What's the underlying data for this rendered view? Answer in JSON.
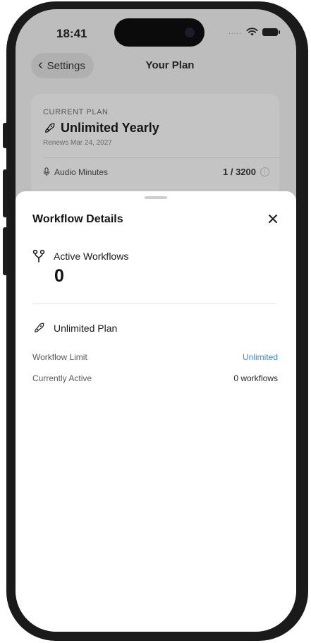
{
  "status_bar": {
    "time": "18:41",
    "signal_text": "....."
  },
  "nav": {
    "back_label": "Settings",
    "title": "Your Plan"
  },
  "plan_card": {
    "label": "CURRENT PLAN",
    "name": "Unlimited Yearly",
    "renews": "Renews Mar 24, 2027",
    "audio_minutes_label": "Audio Minutes",
    "audio_minutes_value": "1 / 3200"
  },
  "sheet": {
    "title": "Workflow Details",
    "active_label": "Active Workflows",
    "active_count": "0",
    "plan_section_label": "Unlimited Plan",
    "rows": [
      {
        "label": "Workflow Limit",
        "value": "Unlimited"
      },
      {
        "label": "Currently Active",
        "value": "0 workflows"
      }
    ]
  },
  "colors": {
    "accent": "#3f86d8",
    "dim_background": "#bdbdbd",
    "sheet_background": "#ffffff"
  },
  "icons": [
    "chevron-left-icon",
    "wifi-icon",
    "battery-icon",
    "rocket-icon",
    "microphone-icon",
    "info-icon",
    "close-icon",
    "branch-icon"
  ]
}
